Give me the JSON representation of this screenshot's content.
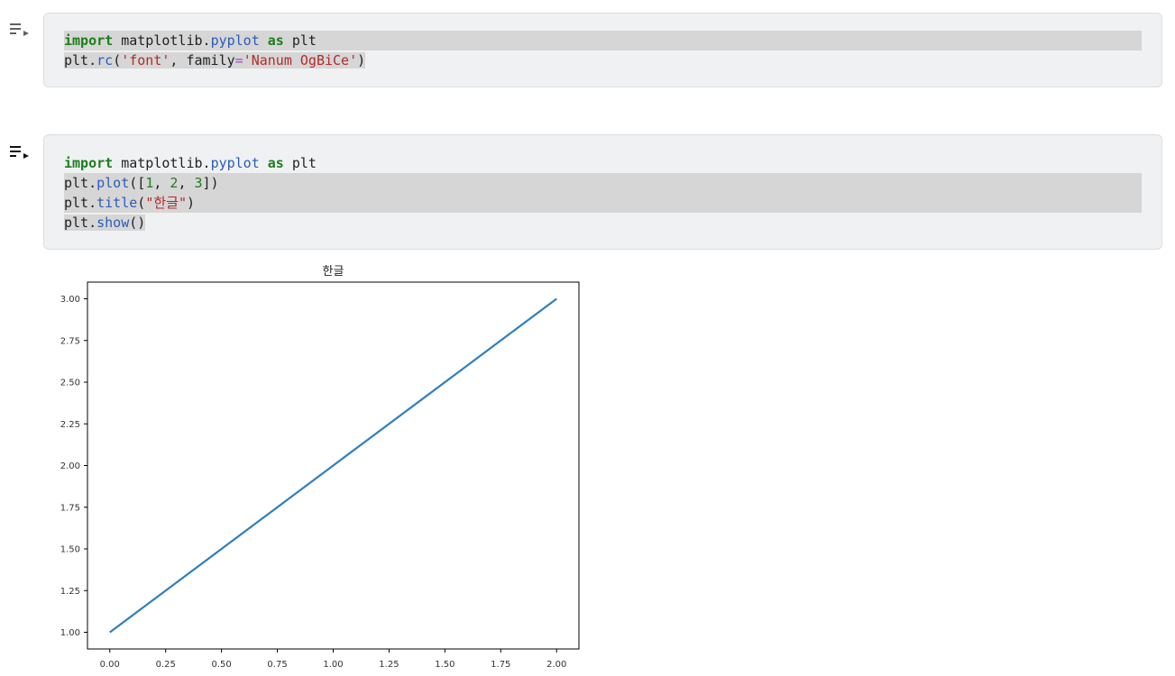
{
  "cells": [
    {
      "lines": [
        [
          {
            "t": "import",
            "c": "kw"
          },
          {
            "t": " matplotlib.",
            "c": ""
          },
          {
            "t": "pyplot",
            "c": "fn"
          },
          {
            "t": " ",
            "c": ""
          },
          {
            "t": "as",
            "c": "kw"
          },
          {
            "t": " plt",
            "c": ""
          }
        ],
        [
          {
            "t": "plt.",
            "c": ""
          },
          {
            "t": "rc",
            "c": "fn"
          },
          {
            "t": "(",
            "c": ""
          },
          {
            "t": "'font'",
            "c": "str"
          },
          {
            "t": ", family",
            "c": ""
          },
          {
            "t": "=",
            "c": "op"
          },
          {
            "t": "'Nanum OgBiCe'",
            "c": "str"
          },
          {
            "t": ")",
            "c": ""
          }
        ]
      ]
    },
    {
      "lines": [
        [
          {
            "t": "import",
            "c": "kw"
          },
          {
            "t": " matplotlib.",
            "c": ""
          },
          {
            "t": "pyplot",
            "c": "fn"
          },
          {
            "t": " ",
            "c": ""
          },
          {
            "t": "as",
            "c": "kw"
          },
          {
            "t": " plt",
            "c": ""
          }
        ],
        [
          {
            "t": "plt.",
            "c": ""
          },
          {
            "t": "plot",
            "c": "fn"
          },
          {
            "t": "([",
            "c": ""
          },
          {
            "t": "1",
            "c": "num"
          },
          {
            "t": ", ",
            "c": ""
          },
          {
            "t": "2",
            "c": "num"
          },
          {
            "t": ", ",
            "c": ""
          },
          {
            "t": "3",
            "c": "num"
          },
          {
            "t": "])",
            "c": ""
          }
        ],
        [
          {
            "t": "plt.",
            "c": ""
          },
          {
            "t": "title",
            "c": "fn"
          },
          {
            "t": "(",
            "c": ""
          },
          {
            "t": "\"한글\"",
            "c": "str"
          },
          {
            "t": ")",
            "c": ""
          }
        ],
        [
          {
            "t": "plt.",
            "c": ""
          },
          {
            "t": "show",
            "c": "fn"
          },
          {
            "t": "()",
            "c": ""
          }
        ]
      ]
    }
  ],
  "chart_data": {
    "type": "line",
    "title": "한글",
    "x": [
      0,
      1,
      2
    ],
    "series": [
      {
        "values": [
          1,
          2,
          3
        ],
        "color": "#2f7fbf"
      }
    ],
    "xlim": [
      -0.1,
      2.1
    ],
    "ylim": [
      0.9,
      3.1
    ],
    "x_ticks": [
      0.0,
      0.25,
      0.5,
      0.75,
      1.0,
      1.25,
      1.5,
      1.75,
      2.0
    ],
    "x_tick_labels": [
      "0.00",
      "0.25",
      "0.50",
      "0.75",
      "1.00",
      "1.25",
      "1.50",
      "1.75",
      "2.00"
    ],
    "y_ticks": [
      1.0,
      1.25,
      1.5,
      1.75,
      2.0,
      2.25,
      2.5,
      2.75,
      3.0
    ],
    "y_tick_labels": [
      "1.00",
      "1.25",
      "1.50",
      "1.75",
      "2.00",
      "2.25",
      "2.50",
      "2.75",
      "3.00"
    ],
    "grid": false,
    "xlabel": "",
    "ylabel": ""
  }
}
